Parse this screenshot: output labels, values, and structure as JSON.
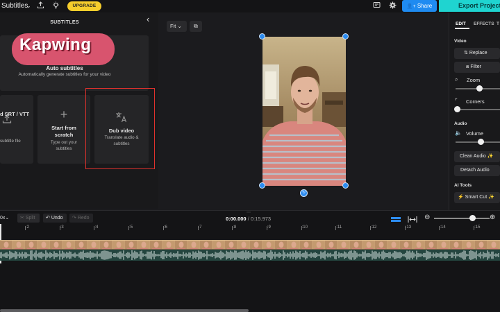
{
  "topbar": {
    "title": "Subtitles",
    "upgrade_label": "UPGRADE",
    "share_label": "Share",
    "export_label": "Export Project",
    "icons": [
      "chevron-down-icon",
      "upload-icon",
      "lightbulb-icon",
      "comment-icon",
      "gear-icon",
      "person-add-icon"
    ]
  },
  "left_panel": {
    "title": "SUBTITLES",
    "logo_text": "Kapwing",
    "auto": {
      "title": "Auto subtitles",
      "desc": "Automatically generate subtitles for your video"
    },
    "srt": {
      "title": "d SRT / VTT",
      "desc": "subtitle file"
    },
    "scratch": {
      "title_1": "Start from",
      "title_2": "scratch",
      "desc_1": "Type out your",
      "desc_2": "subtitles"
    },
    "dub": {
      "title": "Dub video",
      "desc_1": "Translate audio &",
      "desc_2": "subtitles"
    }
  },
  "canvas": {
    "fit_label": "Fit"
  },
  "right_panel": {
    "tabs": [
      "EDIT",
      "EFFECTS",
      "T"
    ],
    "video_label": "Video",
    "replace_label": "Replace",
    "filter_label": "Filter",
    "zoom_label": "Zoom",
    "zoom_level": 0.45,
    "corners_label": "Corners",
    "corners_level": 0.0,
    "audio_label": "Audio",
    "volume_label": "Volume",
    "volume_level": 0.55,
    "clean_audio_label": "Clean Audio",
    "detach_audio_label": "Detach Audio",
    "ai_tools_label": "AI Tools",
    "smart_cut_label": "Smart Cut"
  },
  "timeline": {
    "speed_label": "0x",
    "split_label": "Split",
    "undo_label": "Undo",
    "redo_label": "Redo",
    "current_time": "0:00.000",
    "separator": "/",
    "total_time": "0:15.973",
    "ticks": [
      ":2",
      ":3",
      ":4",
      ":5",
      ":6",
      ":7",
      ":8",
      ":9",
      ":10",
      ":11",
      ":12",
      ":13",
      ":14",
      ":15"
    ],
    "zoom_level": 0.7
  },
  "colors": {
    "accent": "#1f8bf1",
    "export": "#1fd4d0",
    "upgrade": "#f6cd2c",
    "highlight": "#e0322d",
    "logo": "#d8546e"
  }
}
